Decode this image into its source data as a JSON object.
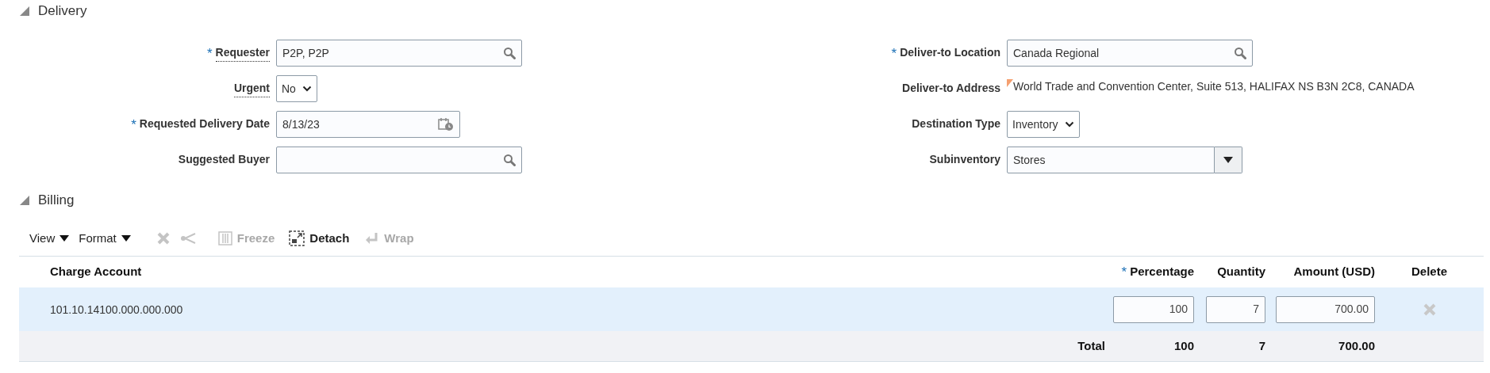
{
  "delivery": {
    "title": "Delivery",
    "expanded": true,
    "left_fields": [
      {
        "marker": "*",
        "label": "Requester",
        "help": true,
        "kind": "search",
        "value": "P2P, P2P"
      },
      {
        "label": "Urgent",
        "help": true,
        "kind": "select",
        "value": "No"
      },
      {
        "marker": "*",
        "label": "Requested Delivery Date",
        "help": false,
        "kind": "date",
        "value": "8/13/23"
      },
      {
        "label": "Suggested Buyer",
        "help": false,
        "kind": "search"
      }
    ],
    "right_fields": [
      {
        "marker": "*",
        "label": "Deliver-to Location",
        "help": false,
        "kind": "search",
        "value": "Canada Regional"
      },
      {
        "label": "Deliver-to Address",
        "help": false,
        "kind": "text",
        "value": "World Trade and Convention Center, Suite 513, HALIFAX NS B3N 2C8, CANADA"
      },
      {
        "label": "Destination Type",
        "help": false,
        "kind": "select",
        "value": "Inventory"
      },
      {
        "label": "Subinventory",
        "help": false,
        "kind": "combo",
        "value": "Stores"
      }
    ]
  },
  "billing": {
    "title": "Billing",
    "expanded": true,
    "toolbar": [
      {
        "kind": "menu",
        "label": "View",
        "disabled": false
      },
      {
        "kind": "menu",
        "label": "Format",
        "disabled": false
      },
      {
        "kind": "delete",
        "disabled": true
      },
      {
        "kind": "split",
        "disabled": true
      },
      {
        "kind": "freeze",
        "label": "Freeze",
        "disabled": true
      },
      {
        "kind": "detach",
        "label": "Detach",
        "disabled": false
      },
      {
        "kind": "wrap",
        "label": "Wrap",
        "disabled": true
      }
    ],
    "table": {
      "columns": [
        {
          "label": "Charge Account"
        },
        {
          "marker": "*",
          "label": "Percentage"
        },
        {
          "label": "Quantity"
        },
        {
          "label": "Amount (USD)"
        },
        {
          "label": "Delete"
        }
      ],
      "rows": [
        {
          "selected": true,
          "charge_account": "101.10.14100.000.000.000",
          "percentage": "100",
          "quantity": "7",
          "amount": "700.00"
        }
      ],
      "total": {
        "label": "Total",
        "percentage": "100",
        "quantity": "7",
        "amount": "700.00"
      }
    }
  }
}
